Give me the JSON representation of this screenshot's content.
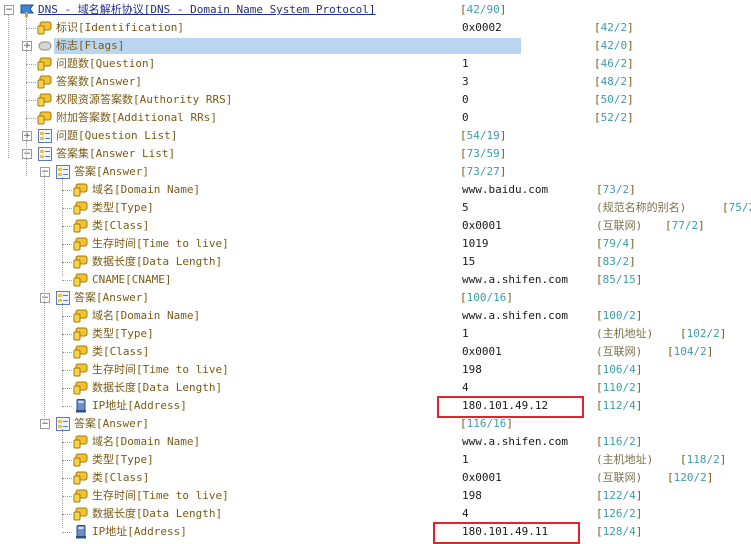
{
  "root": {
    "label": "DNS - 域名解析协议[DNS - Domain Name System Protocol]",
    "range": "42/90"
  },
  "header_fields": [
    {
      "label": "标识[Identification]",
      "value": "0x0002",
      "range": "42/2"
    },
    {
      "label": "标志[Flags]",
      "value": "",
      "range": "42/0"
    },
    {
      "label": "问题数[Question]",
      "value": "1",
      "range": "46/2"
    },
    {
      "label": "答案数[Answer]",
      "value": "3",
      "range": "48/2"
    },
    {
      "label": "权限资源答案数[Authority RRS]",
      "value": "0",
      "range": "50/2"
    },
    {
      "label": "附加答案数[Additional RRs]",
      "value": "0",
      "range": "52/2"
    }
  ],
  "question_list": {
    "label": "问题[Question List]",
    "range": "54/19"
  },
  "answer_list": {
    "label": "答案集[Answer List]",
    "range": "73/59"
  },
  "answers": [
    {
      "label": "答案[Answer]",
      "range": "73/27",
      "fields": [
        {
          "label": "域名[Domain Name]",
          "value": "www.baidu.com",
          "desc": "",
          "range": "73/2"
        },
        {
          "label": "类型[Type]",
          "value": "5",
          "desc": "(规范名称的别名)",
          "range": "75/2"
        },
        {
          "label": "类[Class]",
          "value": "0x0001",
          "desc": "(互联网)",
          "range": "77/2"
        },
        {
          "label": "生存时间[Time to live]",
          "value": "1019",
          "desc": "",
          "range": "79/4"
        },
        {
          "label": "数据长度[Data Length]",
          "value": "15",
          "desc": "",
          "range": "83/2"
        },
        {
          "label": "CNAME[CNAME]",
          "value": "www.a.shifen.com",
          "desc": "",
          "range": "85/15"
        }
      ]
    },
    {
      "label": "答案[Answer]",
      "range": "100/16",
      "fields": [
        {
          "label": "域名[Domain Name]",
          "value": "www.a.shifen.com",
          "desc": "",
          "range": "100/2"
        },
        {
          "label": "类型[Type]",
          "value": "1",
          "desc": "(主机地址)",
          "range": "102/2"
        },
        {
          "label": "类[Class]",
          "value": "0x0001",
          "desc": "(互联网)",
          "range": "104/2"
        },
        {
          "label": "生存时间[Time to live]",
          "value": "198",
          "desc": "",
          "range": "106/4"
        },
        {
          "label": "数据长度[Data Length]",
          "value": "4",
          "desc": "",
          "range": "110/2"
        },
        {
          "label": "IP地址[Address]",
          "value": "180.101.49.12",
          "desc": "",
          "range": "112/4"
        }
      ]
    },
    {
      "label": "答案[Answer]",
      "range": "116/16",
      "fields": [
        {
          "label": "域名[Domain Name]",
          "value": "www.a.shifen.com",
          "desc": "",
          "range": "116/2"
        },
        {
          "label": "类型[Type]",
          "value": "1",
          "desc": "(主机地址)",
          "range": "118/2"
        },
        {
          "label": "类[Class]",
          "value": "0x0001",
          "desc": "(互联网)",
          "range": "120/2"
        },
        {
          "label": "生存时间[Time to live]",
          "value": "198",
          "desc": "",
          "range": "122/4"
        },
        {
          "label": "数据长度[Data Length]",
          "value": "4",
          "desc": "",
          "range": "126/2"
        },
        {
          "label": "IP地址[Address]",
          "value": "180.101.49.11",
          "desc": "",
          "range": "128/4"
        }
      ]
    }
  ],
  "colors": {
    "selection": "#b9d5f0",
    "highlight_box": "#e0242a",
    "root_text": "#1f2f8c",
    "field_text": "#7a5b14"
  }
}
